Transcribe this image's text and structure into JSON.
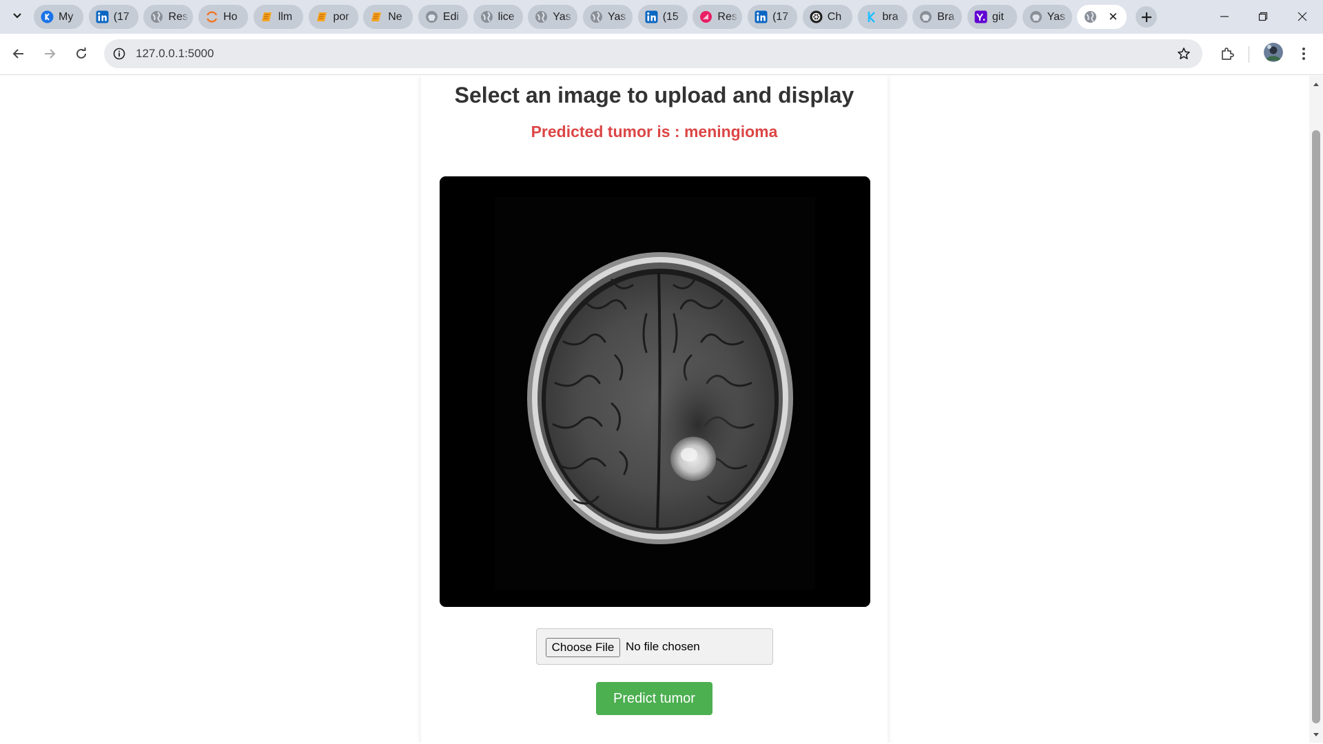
{
  "browser": {
    "tabs": [
      {
        "title": "My",
        "icon": "blue-circle-k-icon"
      },
      {
        "title": "(17",
        "icon": "linkedin-icon"
      },
      {
        "title": "Res",
        "icon": "globe-icon"
      },
      {
        "title": "Ho",
        "icon": "orange-arc-icon"
      },
      {
        "title": "llm",
        "icon": "orange-notebook-icon"
      },
      {
        "title": "por",
        "icon": "orange-notebook-icon"
      },
      {
        "title": "Ne",
        "icon": "orange-notebook-icon"
      },
      {
        "title": "Edi",
        "icon": "github-icon"
      },
      {
        "title": "lice",
        "icon": "globe-icon"
      },
      {
        "title": "Yas",
        "icon": "globe-icon"
      },
      {
        "title": "Yas",
        "icon": "globe-icon"
      },
      {
        "title": "(15",
        "icon": "linkedin-icon"
      },
      {
        "title": "Res",
        "icon": "pink-logo-icon"
      },
      {
        "title": "(17",
        "icon": "linkedin-icon"
      },
      {
        "title": "Ch",
        "icon": "openai-icon"
      },
      {
        "title": "bra",
        "icon": "kaggle-icon"
      },
      {
        "title": "Bra",
        "icon": "github-icon"
      },
      {
        "title": "git",
        "icon": "yahoo-icon"
      },
      {
        "title": "Yas",
        "icon": "github-icon"
      }
    ],
    "active_tab_icon": "globe-icon",
    "address": {
      "url": "127.0.0.1:5000"
    },
    "colors": {
      "tabstrip": "#dfe3eb",
      "tab": "#c6ccd6",
      "omnibox": "#e8eaed"
    }
  },
  "page": {
    "title": "Select an image to upload and display",
    "prediction": "Predicted tumor is : meningioma",
    "image_alt_icon": "brain-mri-scan",
    "file_input": {
      "button_label": "Choose File",
      "status": "No file chosen"
    },
    "predict_button": "Predict tumor",
    "colors": {
      "prediction": "#dc4545",
      "predict_button": "#4caf50",
      "title": "#333333"
    }
  }
}
